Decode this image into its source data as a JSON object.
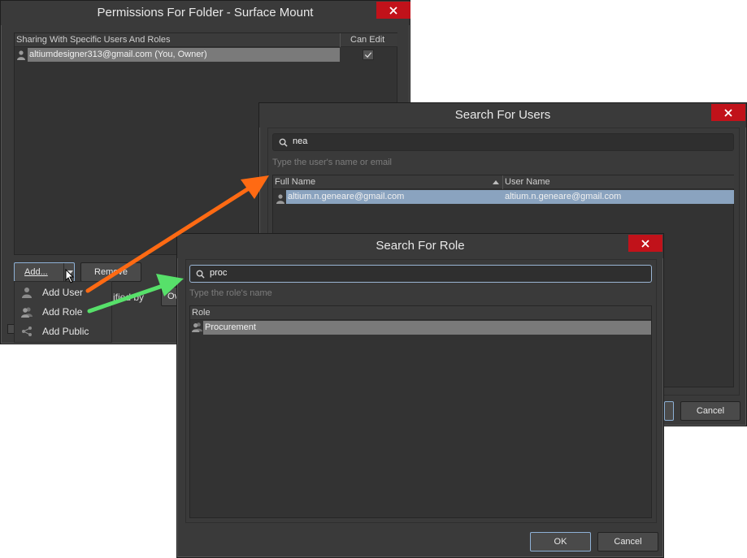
{
  "permissions_dialog": {
    "title": "Permissions For Folder - Surface Mount",
    "table_header_sharing": "Sharing With Specific Users And Roles",
    "table_header_can_edit": "Can Edit",
    "rows": [
      {
        "user": "altiumdesigner313@gmail.com (You, Owner)",
        "can_edit": true
      }
    ],
    "add_label": "Add...",
    "remove_label": "Remove",
    "partial_text": "ified by",
    "partial_select": "Ov"
  },
  "add_menu": {
    "items": [
      {
        "label": "Add User",
        "icon": "user-icon"
      },
      {
        "label": "Add Role",
        "icon": "role-icon"
      },
      {
        "label": "Add Public",
        "icon": "share-icon"
      }
    ]
  },
  "users_dialog": {
    "title": "Search For Users",
    "search_value": "nea",
    "hint": "Type the user's name or email",
    "col_full_name": "Full Name",
    "col_user_name": "User Name",
    "rows": [
      {
        "full_name": "altium.n.geneare@gmail.com",
        "user_name": "altium.n.geneare@gmail.com"
      }
    ],
    "cancel_label": "Cancel"
  },
  "role_dialog": {
    "title": "Search For Role",
    "search_value": "proc",
    "hint": "Type the role's name",
    "col_role": "Role",
    "rows": [
      {
        "role": "Procurement"
      }
    ],
    "ok_label": "OK",
    "cancel_label": "Cancel"
  },
  "colors": {
    "window_bg": "#3a3a3a",
    "close_red": "#c1121a",
    "arrow_orange": "#ff6a13",
    "arrow_green": "#57e06a",
    "selection_blue": "#8aa3bf"
  }
}
